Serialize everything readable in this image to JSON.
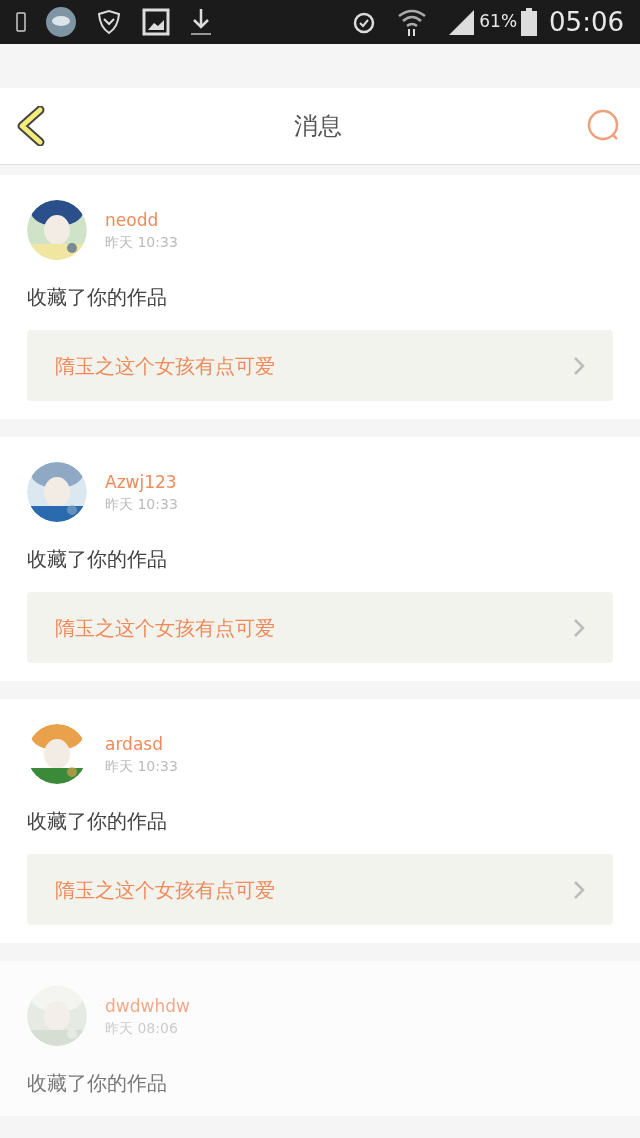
{
  "status_bar": {
    "battery": "61%",
    "time": "05:06"
  },
  "header": {
    "title": "消息"
  },
  "messages": [
    {
      "user": "neodd",
      "time": "昨天 10:33",
      "action": "收藏了你的作品",
      "work": "隋玉之这个女孩有点可爱",
      "faded": false
    },
    {
      "user": "Azwj123",
      "time": "昨天 10:33",
      "action": "收藏了你的作品",
      "work": "隋玉之这个女孩有点可爱",
      "faded": false
    },
    {
      "user": "ardasd",
      "time": "昨天 10:33",
      "action": "收藏了你的作品",
      "work": "隋玉之这个女孩有点可爱",
      "faded": false
    },
    {
      "user": "dwdwhdw",
      "time": "昨天 08:06",
      "action": "收藏了你的作品",
      "faded": true
    }
  ]
}
